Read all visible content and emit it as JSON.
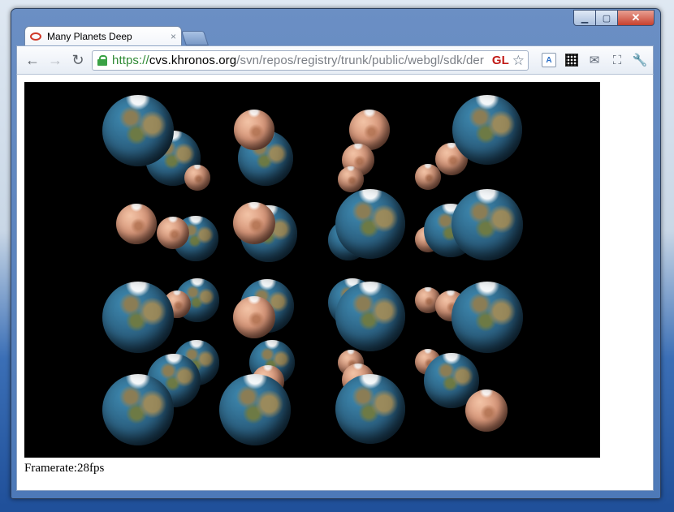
{
  "window": {
    "controls": [
      "minimize-icon",
      "maximize-icon",
      "close-icon"
    ]
  },
  "tab": {
    "title": "Many Planets Deep",
    "close_glyph": "×",
    "favicon": "webgl-ring-icon"
  },
  "toolbar": {
    "back_glyph": "←",
    "forward_glyph": "→",
    "reload_glyph": "↻",
    "url_scheme": "https://",
    "url_host": "cvs.khronos.org",
    "url_path": "/svn/repos/registry/trunk/public/webgl/sdk/der",
    "gl_badge": "GL",
    "star_glyph": "☆",
    "translate_glyph": "A",
    "mail_glyph": "✉",
    "fullscreen_glyph": "⛶",
    "wrench_glyph": "🔧"
  },
  "page": {
    "framerate_text": "Framerate:28fps"
  },
  "colors": {
    "canvas_background": "#000000",
    "https_green": "#2f8a34",
    "gl_red": "#c11b17"
  }
}
